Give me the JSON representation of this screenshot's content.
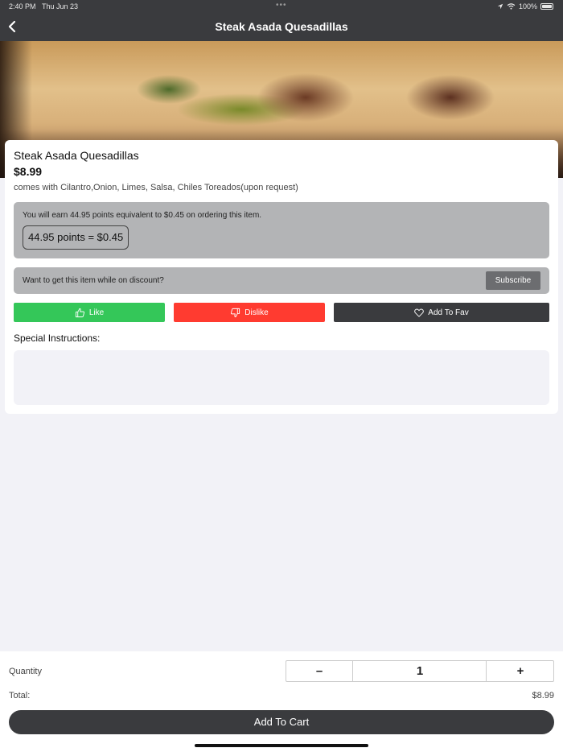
{
  "status_bar": {
    "time": "2:40 PM",
    "date": "Thu Jun 23",
    "battery": "100%"
  },
  "nav": {
    "title": "Steak Asada Quesadillas",
    "back_icon": "chevron-left-icon"
  },
  "item": {
    "name": "Steak Asada Quesadillas",
    "price": "$8.99",
    "description": "comes with Cilantro,Onion, Limes, Salsa, Chiles Toreados(upon request)"
  },
  "points": {
    "earn_text": "You will earn 44.95 points equivalent to $0.45 on ordering this item.",
    "badge": "44.95 points = $0.45"
  },
  "discount": {
    "text": "Want to get this item while on discount?",
    "subscribe_label": "Subscribe"
  },
  "actions": {
    "like_label": "Like",
    "dislike_label": "Dislike",
    "fav_label": "Add To Fav",
    "colors": {
      "like": "#34c759",
      "dislike": "#ff3b30",
      "fav": "#3a3b3e"
    }
  },
  "instructions": {
    "label": "Special Instructions:",
    "value": ""
  },
  "order": {
    "quantity_label": "Quantity",
    "minus": "–",
    "quantity": "1",
    "plus": "+",
    "total_label": "Total:",
    "total_value": "$8.99",
    "add_to_cart_label": "Add To Cart"
  }
}
